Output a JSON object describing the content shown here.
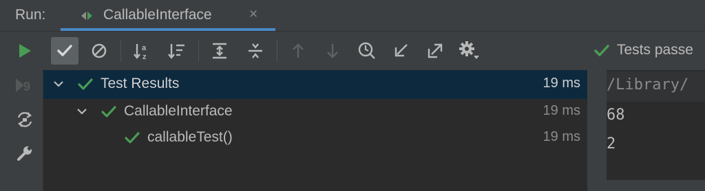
{
  "header": {
    "run_label": "Run:",
    "tab_title": "CallableInterface",
    "tab_close": "×"
  },
  "toolbar": {
    "buttons": [
      {
        "icon": "play-icon",
        "color": "#499c54"
      },
      {
        "icon": "show-passed-check-icon",
        "toggled": true
      },
      {
        "icon": "show-ignored-icon"
      },
      {
        "icon": "sort-alphabetically-icon"
      },
      {
        "icon": "sort-by-duration-icon"
      },
      {
        "icon": "expand-all-icon"
      },
      {
        "icon": "collapse-all-icon"
      },
      {
        "icon": "previous-failed-icon",
        "disabled": true
      },
      {
        "icon": "next-failed-icon",
        "disabled": true
      },
      {
        "icon": "test-history-icon"
      },
      {
        "icon": "import-tests-icon"
      },
      {
        "icon": "export-tests-icon"
      },
      {
        "icon": "settings-gear-icon"
      }
    ],
    "status_text": "Tests passe"
  },
  "left_strip": [
    {
      "icon": "rerun-failed-icon",
      "disabled": true
    },
    {
      "icon": "toggle-auto-test-icon"
    },
    {
      "icon": "wrench-icon"
    }
  ],
  "tree": {
    "rows": [
      {
        "label": "Test Results",
        "time": "19 ms",
        "expanded": true,
        "status": "passed",
        "selected": true
      },
      {
        "label": "CallableInterface",
        "time": "19 ms",
        "expanded": true,
        "status": "passed"
      },
      {
        "label": "callableTest()",
        "time": "19 ms",
        "status": "passed"
      }
    ]
  },
  "console": {
    "lines": [
      "/Library/",
      "68",
      "2"
    ]
  },
  "colors": {
    "pass_green": "#499c54",
    "selection": "#0d293e",
    "tab_underline": "#4a88c7"
  }
}
